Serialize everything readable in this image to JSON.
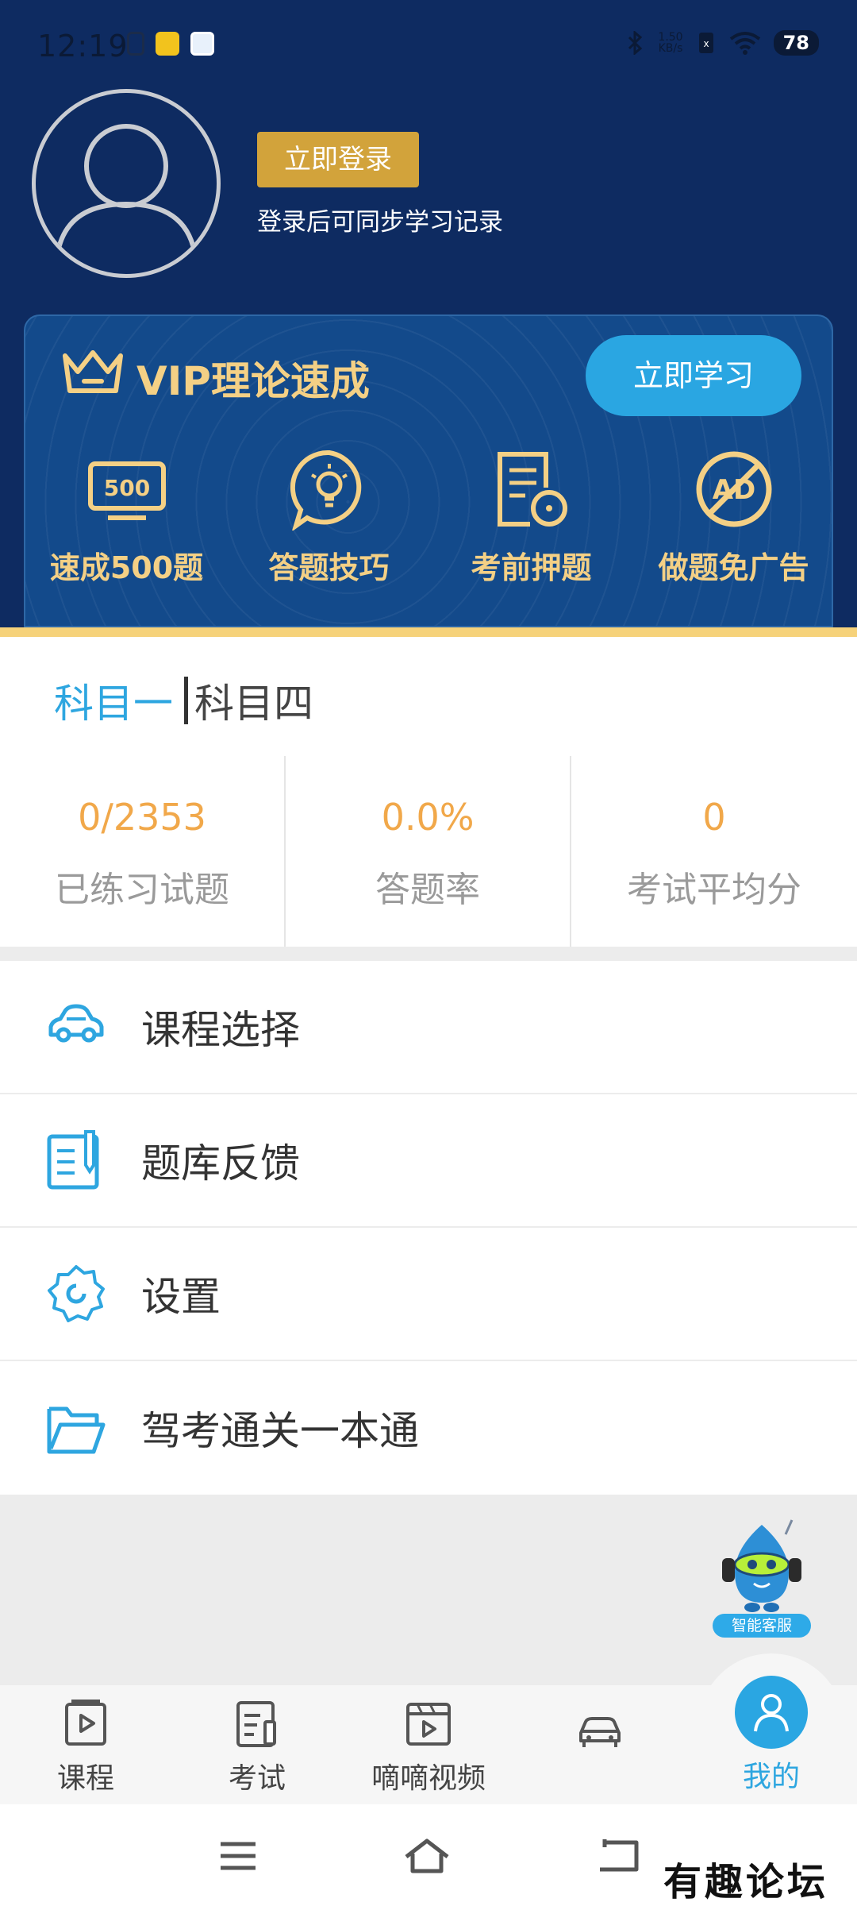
{
  "status_bar": {
    "time": "12:19",
    "net_speed_value": "1.50",
    "net_speed_unit": "KB/s",
    "battery": "78"
  },
  "profile": {
    "login_button": "立即登录",
    "login_hint": "登录后可同步学习记录"
  },
  "vip": {
    "title": "VIP理论速成",
    "study_button": "立即学习",
    "features": [
      {
        "label": "速成500题",
        "icon": "500-icon",
        "icon_text": "500"
      },
      {
        "label": "答题技巧",
        "icon": "lightbulb-icon"
      },
      {
        "label": "考前押题",
        "icon": "exam-target-icon"
      },
      {
        "label": "做题免广告",
        "icon": "no-ad-icon",
        "icon_text": "AD"
      }
    ]
  },
  "subjects": {
    "active": "科目一",
    "inactive": "科目四"
  },
  "stats": [
    {
      "value": "0/2353",
      "label": "已练习试题"
    },
    {
      "value": "0.0%",
      "label": "答题率"
    },
    {
      "value": "0",
      "label": "考试平均分"
    }
  ],
  "menu": [
    {
      "label": "课程选择",
      "icon": "car-icon"
    },
    {
      "label": "题库反馈",
      "icon": "feedback-icon"
    },
    {
      "label": "设置",
      "icon": "gear-icon"
    },
    {
      "label": "驾考通关一本通",
      "icon": "folder-icon"
    }
  ],
  "mascot": {
    "label": "智能客服"
  },
  "bottom_nav": [
    {
      "label": "课程",
      "icon": "course-icon"
    },
    {
      "label": "考试",
      "icon": "exam-icon"
    },
    {
      "label": "嘀嘀视频",
      "icon": "video-icon"
    },
    {
      "label": "",
      "icon": "car-icon"
    },
    {
      "label": "我的",
      "icon": "profile-icon",
      "active": true
    }
  ],
  "watermark": "有趣论坛",
  "colors": {
    "header_bg": "#0e2b61",
    "accent_blue": "#2aa6e2",
    "gold": "#f4d085",
    "stat_orange": "#f1a84a",
    "login_gold": "#d2a33b"
  }
}
